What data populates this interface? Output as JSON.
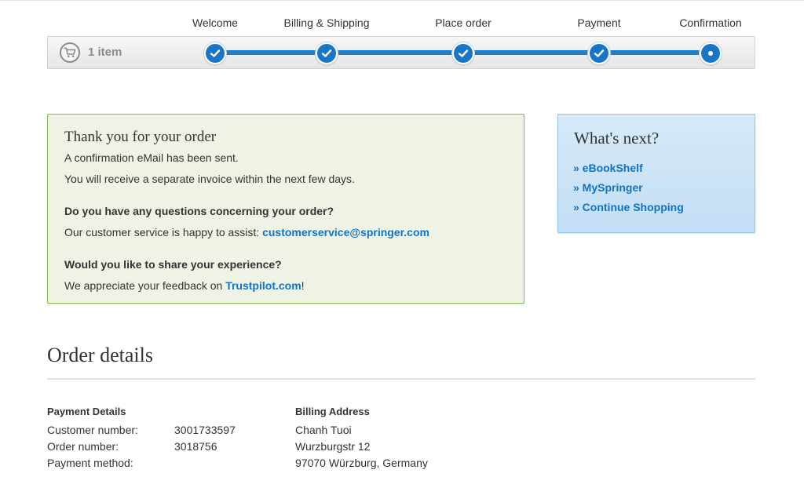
{
  "steps": [
    {
      "label": "Welcome",
      "state": "done"
    },
    {
      "label": "Billing & Shipping",
      "state": "done"
    },
    {
      "label": "Place order",
      "state": "done"
    },
    {
      "label": "Payment",
      "state": "done"
    },
    {
      "label": "Confirmation",
      "state": "current"
    }
  ],
  "cart": {
    "count_label": "1 item",
    "icon": "cart-icon"
  },
  "thanks": {
    "title": "Thank you for your order",
    "line1": "A confirmation eMail has been sent.",
    "line2": "You will receive a separate invoice within the next few days.",
    "question1": "Do you have any questions concerning your order?",
    "assist_prefix": "Our customer service is happy to assist: ",
    "assist_email": "customerservice@springer.com",
    "question2": "Would you like to share your experience?",
    "feedback_prefix": "We appreciate your feedback on ",
    "feedback_link": "Trustpilot.com",
    "feedback_suffix": "!"
  },
  "whats_next": {
    "title": "What's next?",
    "links": [
      "» eBookShelf",
      "» MySpringer",
      "» Continue Shopping"
    ]
  },
  "order": {
    "title": "Order details",
    "payment": {
      "heading": "Payment Details",
      "rows": [
        {
          "label": "Customer number:",
          "value": "3001733597"
        },
        {
          "label": "Order number:",
          "value": "3018756"
        },
        {
          "label": "Payment method:",
          "value": ""
        }
      ]
    },
    "billing": {
      "heading": "Billing Address",
      "lines": [
        "Chanh Tuoi",
        "Wurzburgstr 12",
        "97070 Würzburg, Germany"
      ]
    }
  },
  "colors": {
    "accent": "#1976c7",
    "link": "#1173c4",
    "success_bg": "#eef3e6",
    "success_border": "#8fba57",
    "info_bg": "#cfe5f7",
    "info_border": "#90c2ea"
  }
}
